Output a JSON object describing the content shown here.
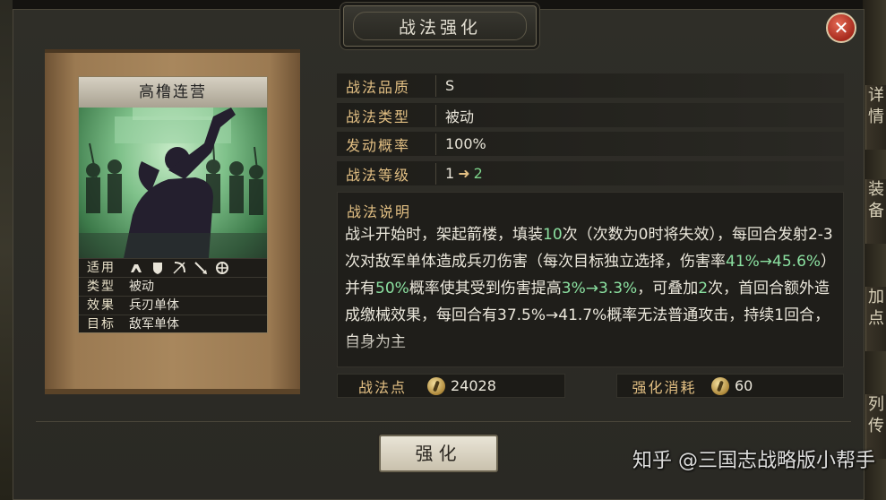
{
  "window": {
    "title": "战法强化",
    "close_label": "✕"
  },
  "side_tabs": [
    "详情",
    "装备",
    "加点",
    "列传"
  ],
  "card": {
    "name": "高橹连营",
    "rows": [
      {
        "label": "适用",
        "icons": [
          "cavalry-icon",
          "shield-icon",
          "bow-icon",
          "spear-icon",
          "siege-icon"
        ]
      },
      {
        "label": "类型",
        "value": "被动"
      },
      {
        "label": "效果",
        "value": "兵刃单体"
      },
      {
        "label": "目标",
        "value": "敌军单体"
      }
    ]
  },
  "attributes": {
    "quality": {
      "label": "战法品质",
      "value": "S"
    },
    "type": {
      "label": "战法类型",
      "value": "被动"
    },
    "trigger_rate": {
      "label": "发动概率",
      "value": "100%"
    },
    "level": {
      "label": "战法等级",
      "from": "1",
      "arrow": "➜",
      "to": "2"
    }
  },
  "description": {
    "title": "战法说明",
    "segments": [
      {
        "text": "战斗开始时，架起箭楼，填装",
        "hl": false
      },
      {
        "text": "10",
        "hl": true
      },
      {
        "text": "次（次数为0时将失效），每回合发射2-3次对敌军单体造成兵刃伤害（每次目标独立选择，伤害率",
        "hl": false
      },
      {
        "text": "41%→45.6%",
        "hl": true
      },
      {
        "text": "）并有",
        "hl": false
      },
      {
        "text": "50%",
        "hl": true
      },
      {
        "text": "概率使其受到伤害提高",
        "hl": false
      },
      {
        "text": "3%→3.3%",
        "hl": true
      },
      {
        "text": "，可叠加",
        "hl": false
      },
      {
        "text": "2",
        "hl": true
      },
      {
        "text": "次，首回合额外造成缴械效果，每回合",
        "hl": false
      },
      {
        "text": "有37.5%→41.7%概率无法普通攻击，持续1回合，自身为主",
        "hl": false
      }
    ]
  },
  "stats": {
    "points": {
      "label": "战法点",
      "value": "24028"
    },
    "cost": {
      "label": "强化消耗",
      "value": "60"
    }
  },
  "strengthen_button": "强化",
  "watermark": "知乎 @三国志战略版小帮手",
  "colors": {
    "accent_label": "#e2bf83",
    "highlight_green": "#7dd28a",
    "close_red": "#c0392b"
  }
}
